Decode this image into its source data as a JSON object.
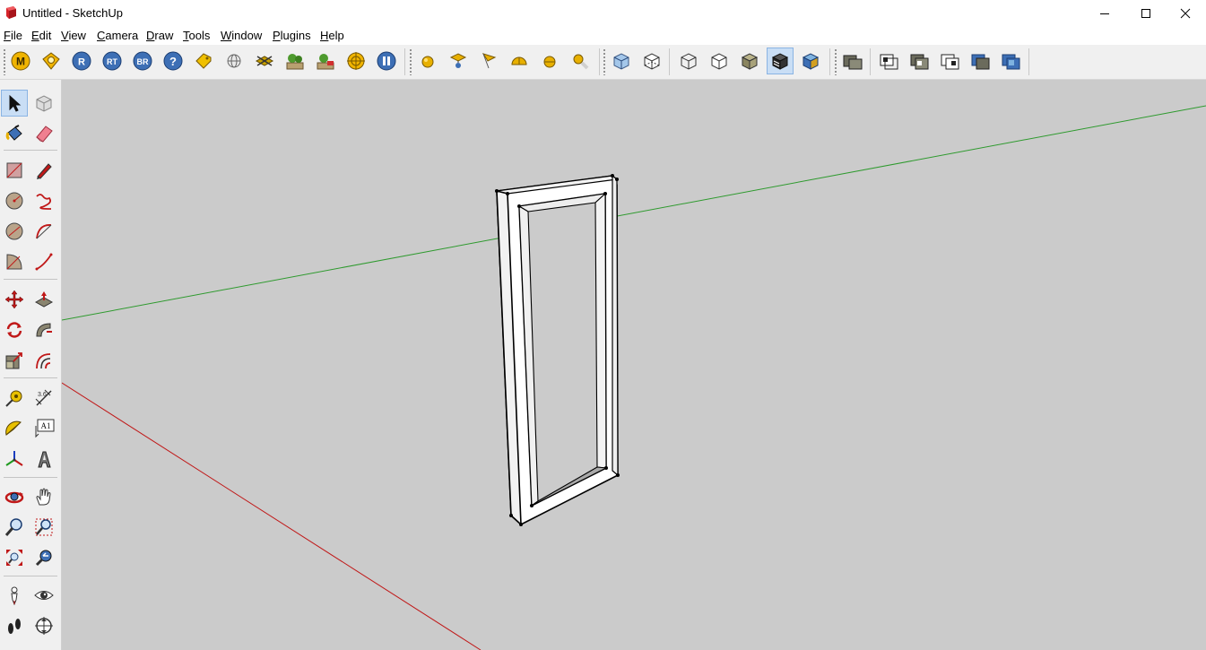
{
  "window": {
    "title": "Untitled - SketchUp"
  },
  "menu": {
    "items": [
      {
        "pre": "",
        "u": "F",
        "post": "ile"
      },
      {
        "pre": "",
        "u": "E",
        "post": "dit"
      },
      {
        "pre": "",
        "u": "V",
        "post": "iew"
      },
      {
        "pre": "",
        "u": "C",
        "post": "amera"
      },
      {
        "pre": "",
        "u": "D",
        "post": "raw"
      },
      {
        "pre": "",
        "u": "T",
        "post": "ools"
      },
      {
        "pre": "",
        "u": "W",
        "post": "indow"
      },
      {
        "pre": "",
        "u": "P",
        "post": "lugins"
      },
      {
        "pre": "",
        "u": "H",
        "post": "elp"
      }
    ]
  },
  "toolbar": {
    "lettered_buttons": [
      "M",
      "R",
      "RT",
      "BR"
    ],
    "active_style": "monochrome"
  },
  "palette": {
    "text_label": "A1"
  },
  "colors": {
    "viewport_bg": "#cbcbcb",
    "green_axis": "#2e9a2e",
    "red_axis": "#c01818",
    "accent_active": "#c9def5"
  }
}
